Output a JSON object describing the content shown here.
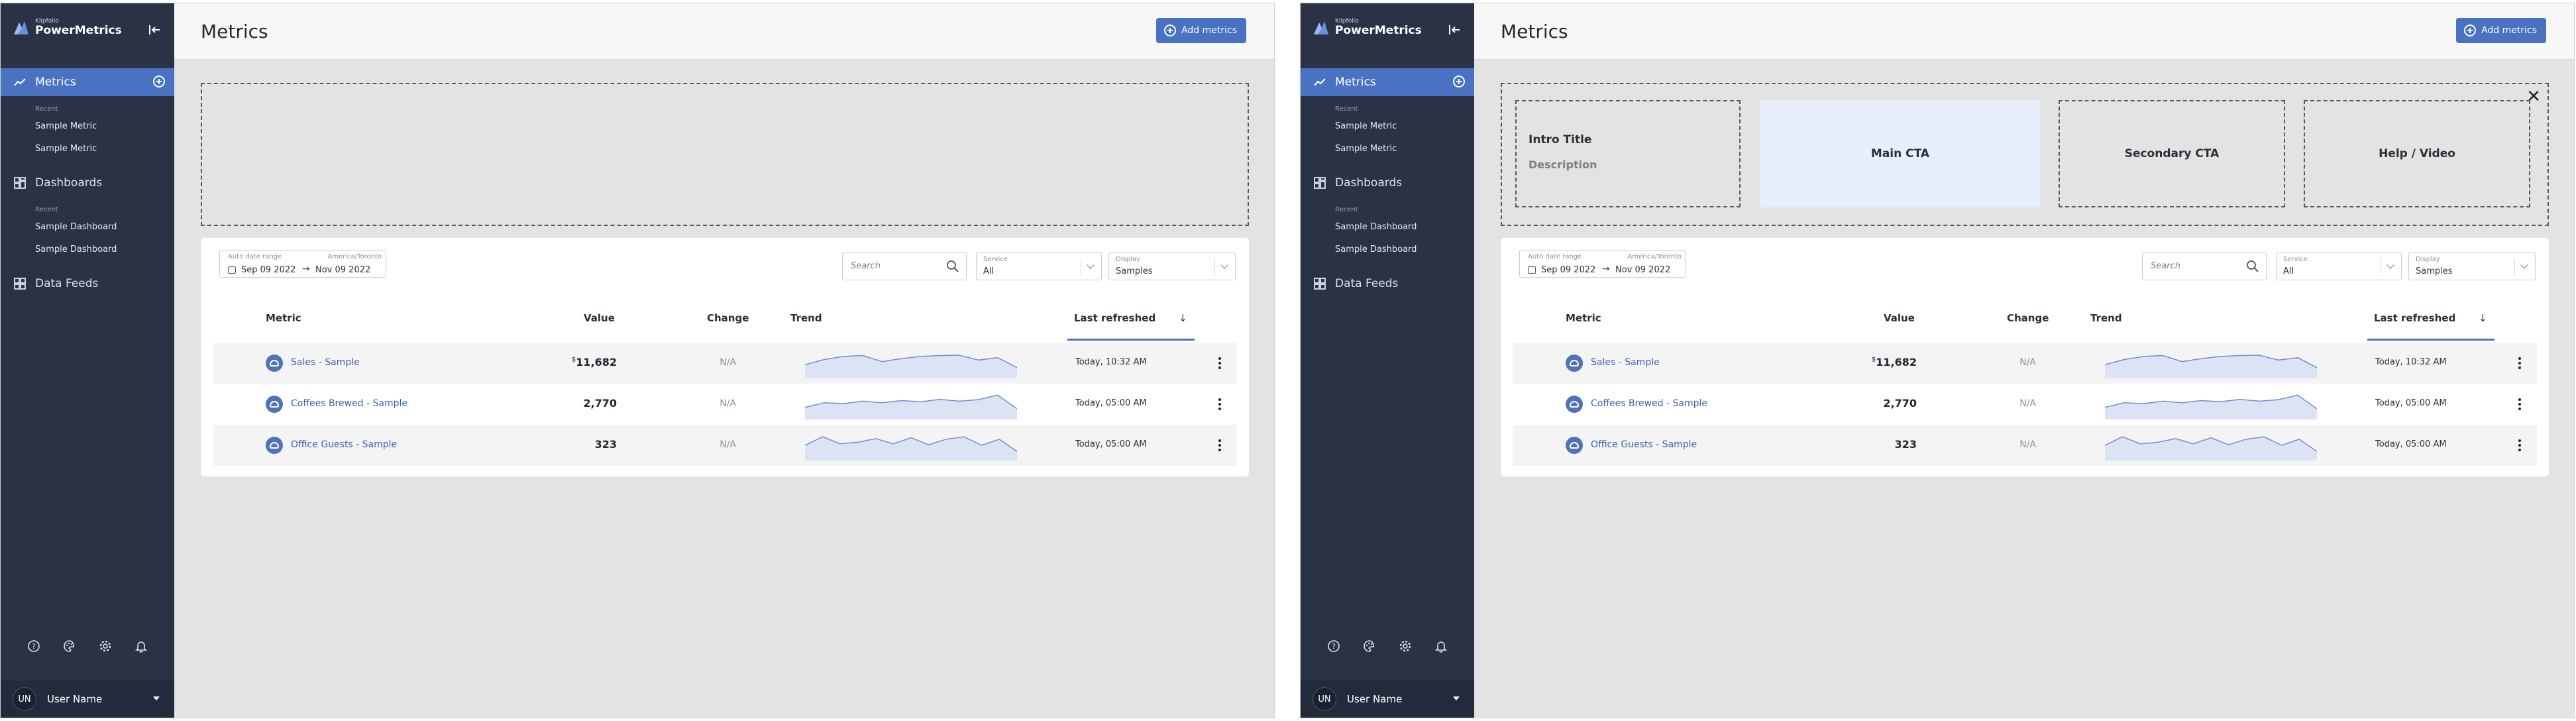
{
  "app": {
    "logo_small": "Klipfolio",
    "logo_main": "PowerMetrics"
  },
  "sidebar": {
    "metrics_label": "Metrics",
    "metrics_recent_label": "Recent",
    "metrics_recent": [
      "Sample Metric",
      "Sample Metric"
    ],
    "dashboards_label": "Dashboards",
    "dashboards_recent_label": "Recent",
    "dashboards_recent": [
      "Sample Dashboard",
      "Sample Dashboard"
    ],
    "data_feeds_label": "Data Feeds",
    "icons": [
      "help-icon",
      "palette-icon",
      "gear-icon",
      "bell-icon"
    ],
    "user": {
      "initials": "UN",
      "name": "User Name"
    }
  },
  "header": {
    "title": "Metrics",
    "add_button": "Add metrics"
  },
  "intro_panel": {
    "intro_title": "Intro Title",
    "description": "Description",
    "main_cta": "Main CTA",
    "secondary_cta": "Secondary CTA",
    "help_video": "Help / Video",
    "close_glyph": "✕"
  },
  "filters": {
    "date_label": "Auto date range",
    "timezone": "America/Toronto",
    "date_from": "Sep 09 2022",
    "date_to": "Nov 09 2022",
    "search_placeholder": "Search",
    "service_label": "Service",
    "service_value": "All",
    "display_label": "Display",
    "display_value": "Samples"
  },
  "table": {
    "columns": {
      "metric": "Metric",
      "value": "Value",
      "change": "Change",
      "trend": "Trend",
      "last_refreshed": "Last refreshed",
      "sort_glyph": "↓"
    },
    "rows": [
      {
        "name": "Sales - Sample",
        "value_prefix": "$",
        "value": "11,682",
        "change": "N/A",
        "refreshed": "Today, 10:32 AM",
        "trend": [
          0.45,
          0.62,
          0.72,
          0.75,
          0.55,
          0.65,
          0.72,
          0.75,
          0.76,
          0.6,
          0.68,
          0.35
        ]
      },
      {
        "name": "Coffees Brewed - Sample",
        "value_prefix": "",
        "value": "2,770",
        "change": "N/A",
        "refreshed": "Today, 05:00 AM",
        "trend": [
          0.4,
          0.55,
          0.52,
          0.6,
          0.55,
          0.62,
          0.58,
          0.66,
          0.6,
          0.65,
          0.8,
          0.35
        ]
      },
      {
        "name": "Office Guests - Sample",
        "value_prefix": "",
        "value": "323",
        "change": "N/A",
        "refreshed": "Today, 05:00 AM",
        "trend": [
          0.5,
          0.78,
          0.55,
          0.6,
          0.72,
          0.55,
          0.75,
          0.52,
          0.7,
          0.78,
          0.5,
          0.7,
          0.3
        ]
      }
    ]
  },
  "colors": {
    "sidebar": "#2b3245",
    "accent": "#4a72c3",
    "background": "#e3e3e3",
    "main_cta_bg": "#e8eefc"
  }
}
